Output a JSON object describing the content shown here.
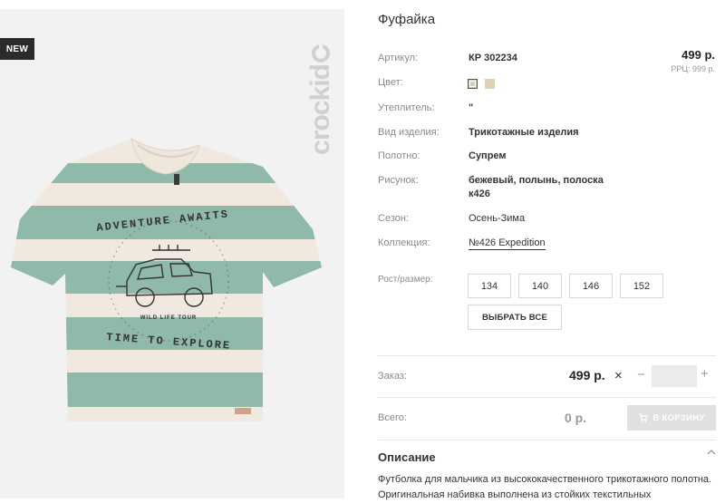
{
  "badge": "NEW",
  "brand": "crockid",
  "graphic": {
    "top_text": "ADVENTURE AWAITS",
    "bottom_text": "TIME TO EXPLORE",
    "middle_text": "WILD LIFE TOUR"
  },
  "product": {
    "title": "Фуфайка",
    "price": "499 р.",
    "rrc": "РРЦ: 999 р.",
    "specs": [
      {
        "label": "Артикул:",
        "value": "КР 302234"
      },
      {
        "label": "Цвет:",
        "value": ""
      },
      {
        "label": "Утеплитель:",
        "value": "\""
      },
      {
        "label": "Вид изделия:",
        "value": "Трикотажные изделия"
      },
      {
        "label": "Полотно:",
        "value": "Супрем"
      },
      {
        "label": "Рисунок:",
        "value": "бежевый, полынь, полоска",
        "value2": "к426"
      },
      {
        "label": "Сезон:",
        "value": "Осень-Зима"
      },
      {
        "label": "Коллекция:",
        "value": "№426 Expedition"
      }
    ],
    "colors": {
      "swatch_active": "#d6ceb7",
      "swatch_alt": "#dcd3b0",
      "stripe_green": "#8fb9a8",
      "stripe_cream": "#f1e8df"
    }
  },
  "size": {
    "label": "Рост/размер:",
    "options": [
      "134",
      "140",
      "146",
      "152"
    ],
    "select_all": "ВЫБРАТЬ ВСЕ"
  },
  "order": {
    "label": "Заказ:",
    "price": "499 р.",
    "multiply_icon": "×",
    "minus": "−",
    "plus": "+",
    "qty_value": ""
  },
  "total": {
    "label": "Всего:",
    "value": "0 р.",
    "cart_button": "В КОРЗИНУ"
  },
  "description": {
    "title": "Описание",
    "text": "Футболка для мальчика из высококачественного трикотажного полотна. Оригинальная набивка выполнена из стойких текстильных"
  }
}
